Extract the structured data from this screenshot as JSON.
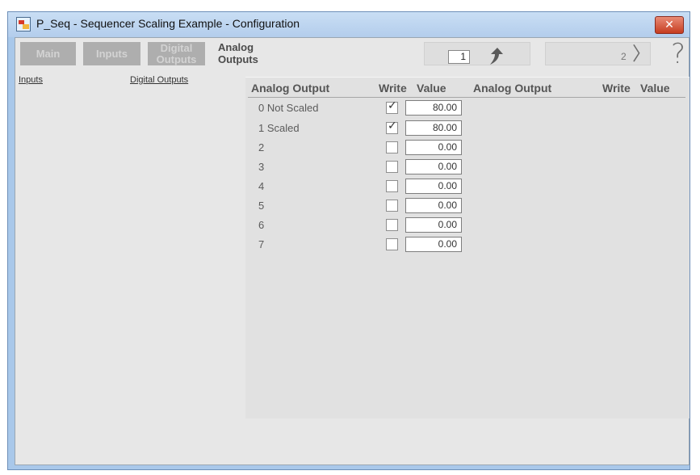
{
  "window": {
    "title": "P_Seq - Sequencer Scaling Example - Configuration",
    "close_glyph": "✕"
  },
  "tabs": [
    {
      "label": "Main",
      "active": false
    },
    {
      "label": "Inputs",
      "active": false
    },
    {
      "label_line1": "Digital",
      "label_line2": "Outputs",
      "active": false
    },
    {
      "label_line1": "Analog",
      "label_line2": "Outputs",
      "active": true
    }
  ],
  "nav": {
    "page_value": "1",
    "next_page": "2",
    "next_glyph": "〉",
    "help_glyph": "?"
  },
  "links": {
    "inputs": "Inputs",
    "digital_outputs": "Digital Outputs"
  },
  "table": {
    "headers": {
      "analog_output": "Analog Output",
      "write": "Write",
      "value": "Value"
    },
    "headers_right": {
      "analog_output": "Analog Output",
      "write": "Write",
      "value": "Value"
    },
    "rows": [
      {
        "label": "0 Not Scaled",
        "write": true,
        "value": "80.00"
      },
      {
        "label": "1 Scaled",
        "write": true,
        "value": "80.00"
      },
      {
        "label": "2",
        "write": false,
        "value": "0.00"
      },
      {
        "label": "3",
        "write": false,
        "value": "0.00"
      },
      {
        "label": "4",
        "write": false,
        "value": "0.00"
      },
      {
        "label": "5",
        "write": false,
        "value": "0.00"
      },
      {
        "label": "6",
        "write": false,
        "value": "0.00"
      },
      {
        "label": "7",
        "write": false,
        "value": "0.00"
      }
    ],
    "check_glyph": "✓"
  },
  "colors": {
    "title_bar": "#b3cdec",
    "tab_inactive": "#aeaeae",
    "close_button": "#c63c20",
    "panel_bg": "#e1e1e1"
  },
  "icons": {
    "app": "faceplate-app-icon",
    "close": "close-icon",
    "up": "up-arrow-icon",
    "next": "chevron-right-icon",
    "help": "help-icon"
  }
}
